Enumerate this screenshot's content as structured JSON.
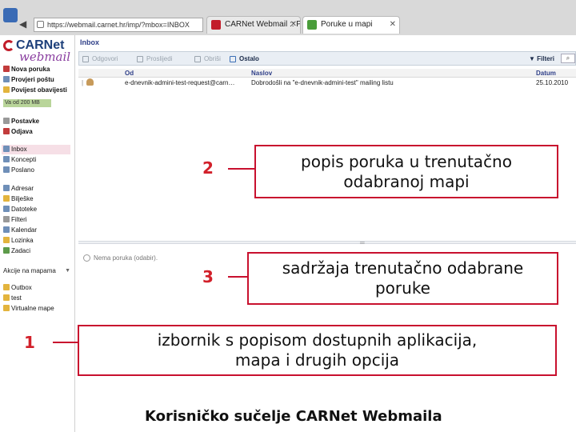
{
  "browser": {
    "url": "https://webmail.carnet.hr/imp/?mbox=INBOX",
    "tabs": [
      {
        "label": "CARNet Webmail :: Prijava",
        "favicon": "carnet-icon"
      },
      {
        "label": "Poruke u mapi",
        "favicon": "page-icon"
      }
    ]
  },
  "sidebar": {
    "logo_brand": "CARNet",
    "logo_script": "webmail",
    "actions": [
      {
        "label": "Nova poruka",
        "icon": "compose-icon"
      },
      {
        "label": "Provjeri poštu",
        "icon": "refresh-icon"
      },
      {
        "label": "Povijest obavijesti",
        "icon": "alerts-icon"
      }
    ],
    "quota": "Va od 200 MB",
    "settings": [
      {
        "label": "Postavke",
        "icon": "gear-icon"
      },
      {
        "label": "Odjava",
        "icon": "logout-icon"
      }
    ],
    "folders": [
      {
        "label": "Inbox",
        "icon": "inbox-icon"
      },
      {
        "label": "Koncepti",
        "icon": "drafts-icon"
      },
      {
        "label": "Poslano",
        "icon": "sent-icon"
      }
    ],
    "apps": [
      {
        "label": "Adresar",
        "icon": "addressbook-icon"
      },
      {
        "label": "Bilješke",
        "icon": "notes-icon"
      },
      {
        "label": "Datoteke",
        "icon": "files-icon"
      },
      {
        "label": "Filteri",
        "icon": "filter-icon"
      },
      {
        "label": "Kalendar",
        "icon": "calendar-icon"
      },
      {
        "label": "Lozinka",
        "icon": "key-icon"
      },
      {
        "label": "Zadaci",
        "icon": "tasks-icon"
      }
    ],
    "folder_actions_label": "Akcije na mapama",
    "other_folders": [
      {
        "label": "Outbox",
        "icon": "folder-icon"
      },
      {
        "label": "test",
        "icon": "folder-icon"
      },
      {
        "label": "Virtualne mape",
        "icon": "folder-icon"
      }
    ]
  },
  "main": {
    "folder_title": "Inbox",
    "toolbar": [
      {
        "label": "Odgovori",
        "enabled": false
      },
      {
        "label": "Proslijedi",
        "enabled": false
      },
      {
        "label": "Obriši",
        "enabled": false
      },
      {
        "label": "Ostalo",
        "enabled": true
      }
    ],
    "filter_label": "Filteri",
    "columns": {
      "from": "Od",
      "subject": "Naslov",
      "date": "Datum"
    },
    "messages": [
      {
        "from": "e-dnevnik-admini-test-request@carn…",
        "subject": "Dobrodošli na \"e-dnevnik-admini-test\" mailing listu",
        "date": "25.10.2010"
      }
    ],
    "preview_empty": "Nema poruka (odabir)."
  },
  "annotations": [
    {
      "number": "2",
      "text": "popis poruka u trenutačno odabranoj mapi"
    },
    {
      "number": "3",
      "text": "sadržaja trenutačno odabrane poruke"
    },
    {
      "number": "1",
      "text": "izbornik s popisom dostupnih aplikacija, mapa i drugih opcija"
    }
  ],
  "caption": "Korisničko sučelje CARNet Webmaila",
  "colors": {
    "accent_red": "#c8102e",
    "brand_blue": "#1d3f7a",
    "selected_row": "#f6dfe6"
  }
}
